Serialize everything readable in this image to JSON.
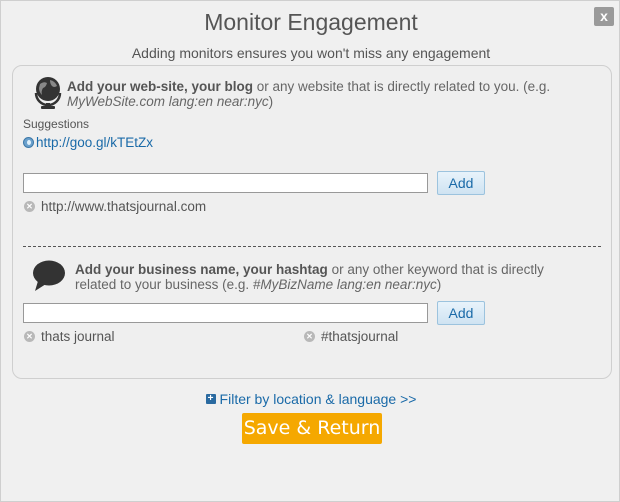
{
  "dialog": {
    "title": "Monitor Engagement",
    "subtitle": "Adding monitors ensures you won't miss any engagement",
    "close_label": "x"
  },
  "website_section": {
    "bold_text": "Add your web-site, your blog",
    "text": " or any website that is directly related to you. (e.g. ",
    "example": "MyWebSite.com lang:en near:nyc",
    "text_end": ")",
    "suggestions_label": "Suggestions",
    "suggestion_link": "http://goo.gl/kTEtZx",
    "input_value": "",
    "add_label": "Add",
    "tags": [
      "http://www.thatsjournal.com"
    ]
  },
  "keyword_section": {
    "bold_text": "Add your business name, your hashtag",
    "text": " or any other keyword that is directly related to your business (e.g. ",
    "example": "#MyBizName lang:en near:nyc",
    "text_end": ")",
    "input_value": "",
    "add_label": "Add",
    "tags": [
      "thats journal",
      "#thatsjournal"
    ]
  },
  "filter_link": "Filter by location & language >>",
  "save_label": "Save & Return",
  "colors": {
    "accent": "#f5a800",
    "link": "#1a6aa8"
  }
}
